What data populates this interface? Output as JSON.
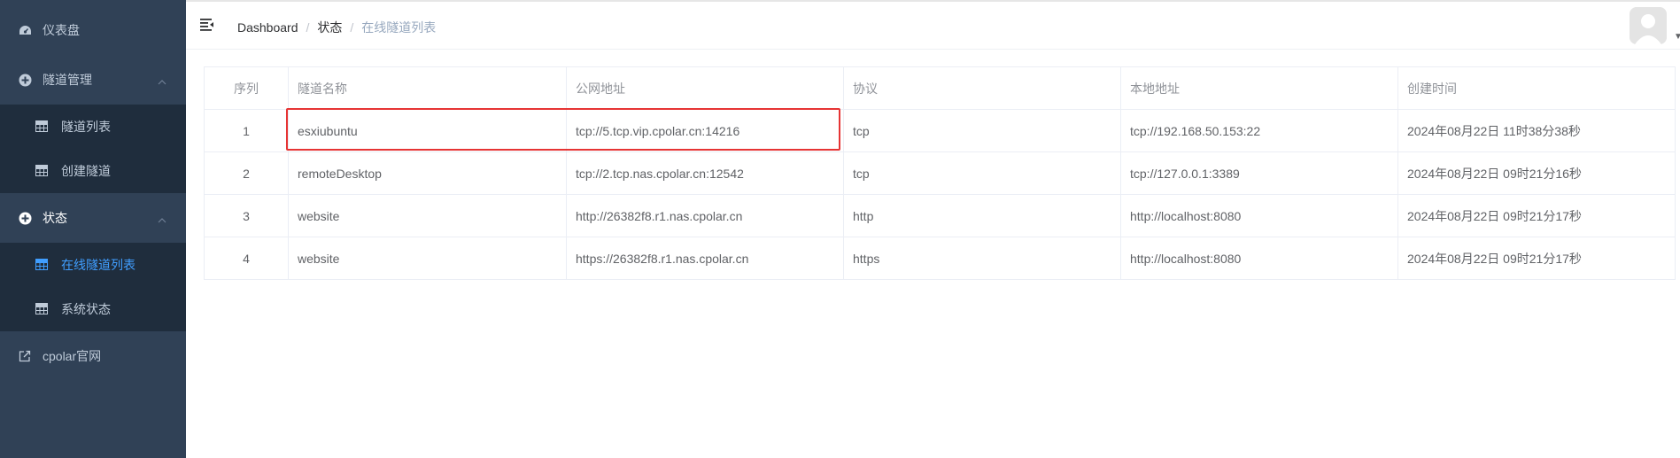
{
  "sidebar": {
    "items": [
      {
        "label": "仪表盘",
        "icon": "dashboard-icon"
      },
      {
        "label": "隧道管理",
        "icon": "tunnel-manage-icon",
        "expanded": true,
        "children": [
          {
            "label": "隧道列表",
            "icon": "table-icon"
          },
          {
            "label": "创建隧道",
            "icon": "table-icon"
          }
        ]
      },
      {
        "label": "状态",
        "icon": "status-icon",
        "expanded": true,
        "children": [
          {
            "label": "在线隧道列表",
            "icon": "table-icon",
            "active": true
          },
          {
            "label": "系统状态",
            "icon": "table-icon"
          }
        ]
      },
      {
        "label": "cpolar官网",
        "icon": "external-link-icon"
      }
    ]
  },
  "header": {
    "breadcrumb": [
      "Dashboard",
      "状态",
      "在线隧道列表"
    ]
  },
  "table": {
    "columns": [
      "序列",
      "隧道名称",
      "公网地址",
      "协议",
      "本地地址",
      "创建时间"
    ],
    "rows": [
      [
        "1",
        "esxiubuntu",
        "tcp://5.tcp.vip.cpolar.cn:14216",
        "tcp",
        "tcp://192.168.50.153:22",
        "2024年08月22日 11时38分38秒"
      ],
      [
        "2",
        "remoteDesktop",
        "tcp://2.tcp.nas.cpolar.cn:12542",
        "tcp",
        "tcp://127.0.0.1:3389",
        "2024年08月22日 09时21分16秒"
      ],
      [
        "3",
        "website",
        "http://26382f8.r1.nas.cpolar.cn",
        "http",
        "http://localhost:8080",
        "2024年08月22日 09时21分17秒"
      ],
      [
        "4",
        "website",
        "https://26382f8.r1.nas.cpolar.cn",
        "https",
        "http://localhost:8080",
        "2024年08月22日 09时21分17秒"
      ]
    ]
  },
  "colors": {
    "sidebar_bg": "#304156",
    "submenu_bg": "#1f2d3d",
    "active": "#409eff",
    "highlight": "#e63434"
  }
}
